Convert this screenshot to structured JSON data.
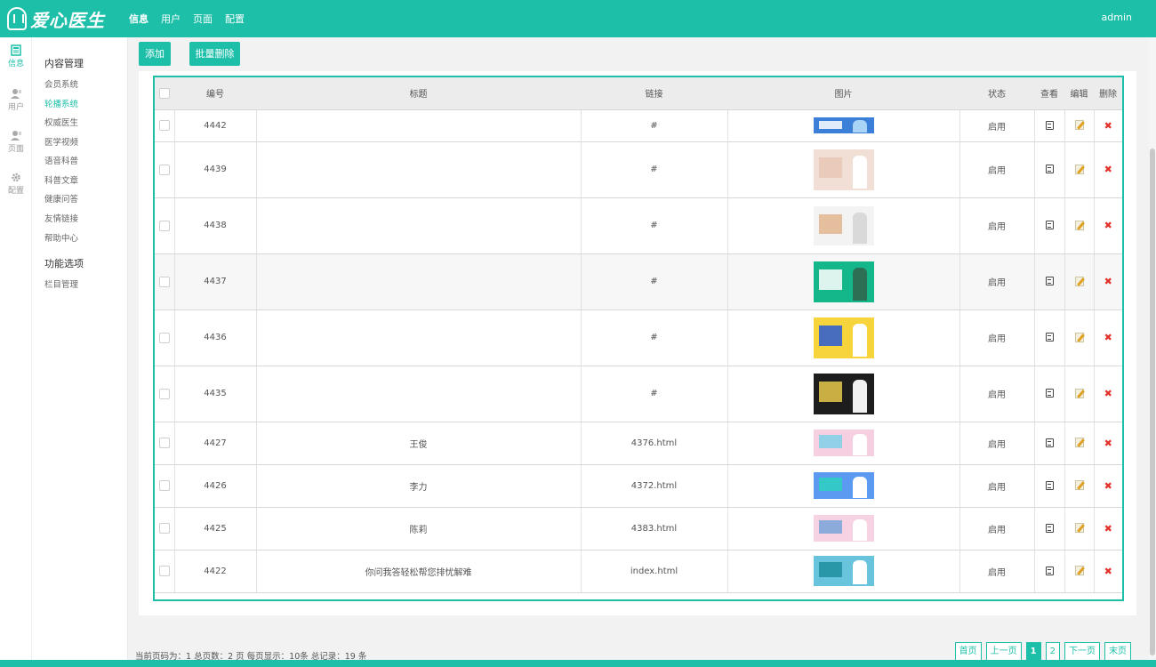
{
  "app": {
    "logo_text": "爱心医生",
    "admin_label": "admin",
    "accent": "#1dbfa9"
  },
  "topnav": [
    {
      "label": "信息",
      "active": true
    },
    {
      "label": "用户",
      "active": false
    },
    {
      "label": "页面",
      "active": false
    },
    {
      "label": "配置",
      "active": false
    }
  ],
  "iconcol": [
    {
      "label": "信息",
      "icon": "doc-icon",
      "active": true
    },
    {
      "label": "用户",
      "icon": "user-icon",
      "active": false
    },
    {
      "label": "页面",
      "icon": "user-icon",
      "active": false
    },
    {
      "label": "配置",
      "icon": "gear-icon",
      "active": false
    }
  ],
  "sidemenu": {
    "group1": "内容管理",
    "items1": [
      "会员系统",
      "轮播系统",
      "权威医生",
      "医学视频",
      "语音科普",
      "科普文章",
      "健康问答",
      "友情链接",
      "帮助中心"
    ],
    "active_item": "轮播系统",
    "group2": "功能选项",
    "items2": [
      "栏目管理"
    ]
  },
  "toolbar": {
    "add_label": "添加",
    "batch_delete_label": "批量删除"
  },
  "table": {
    "headers": [
      "编号",
      "标题",
      "链接",
      "图片",
      "状态",
      "查看",
      "编辑",
      "删除"
    ],
    "rows": [
      {
        "id": "4442",
        "title": "",
        "link": "#",
        "status": "启用",
        "img": "blue-banner"
      },
      {
        "id": "4439",
        "title": "",
        "link": "#",
        "status": "启用",
        "img": "pregnant-photo"
      },
      {
        "id": "4438",
        "title": "",
        "link": "#",
        "status": "启用",
        "img": "sleeping-couple"
      },
      {
        "id": "4437",
        "title": "",
        "link": "#",
        "status": "启用",
        "img": "green-doctor-banner"
      },
      {
        "id": "4436",
        "title": "",
        "link": "#",
        "status": "启用",
        "img": "yellow-doctor-banner"
      },
      {
        "id": "4435",
        "title": "",
        "link": "#",
        "status": "启用",
        "img": "dark-doctor-banner"
      },
      {
        "id": "4427",
        "title": "王俊",
        "link": "4376.html",
        "status": "启用",
        "img": "pink-doctor-banner"
      },
      {
        "id": "4426",
        "title": "李力",
        "link": "4372.html",
        "status": "启用",
        "img": "blue-doctor-banner"
      },
      {
        "id": "4425",
        "title": "陈莉",
        "link": "4383.html",
        "status": "启用",
        "img": "pink-tablet-banner"
      },
      {
        "id": "4422",
        "title": "你问我答轻松帮您排忧解难",
        "link": "index.html",
        "status": "启用",
        "img": "teal-qa-banner"
      }
    ]
  },
  "footer": {
    "page_info": "当前页码为：1 总页数：2 页 每页显示：10条 总记录：19 条",
    "pager": [
      "首页",
      "上一页",
      "1",
      "2",
      "下一页",
      "末页"
    ],
    "current_page": "1"
  }
}
